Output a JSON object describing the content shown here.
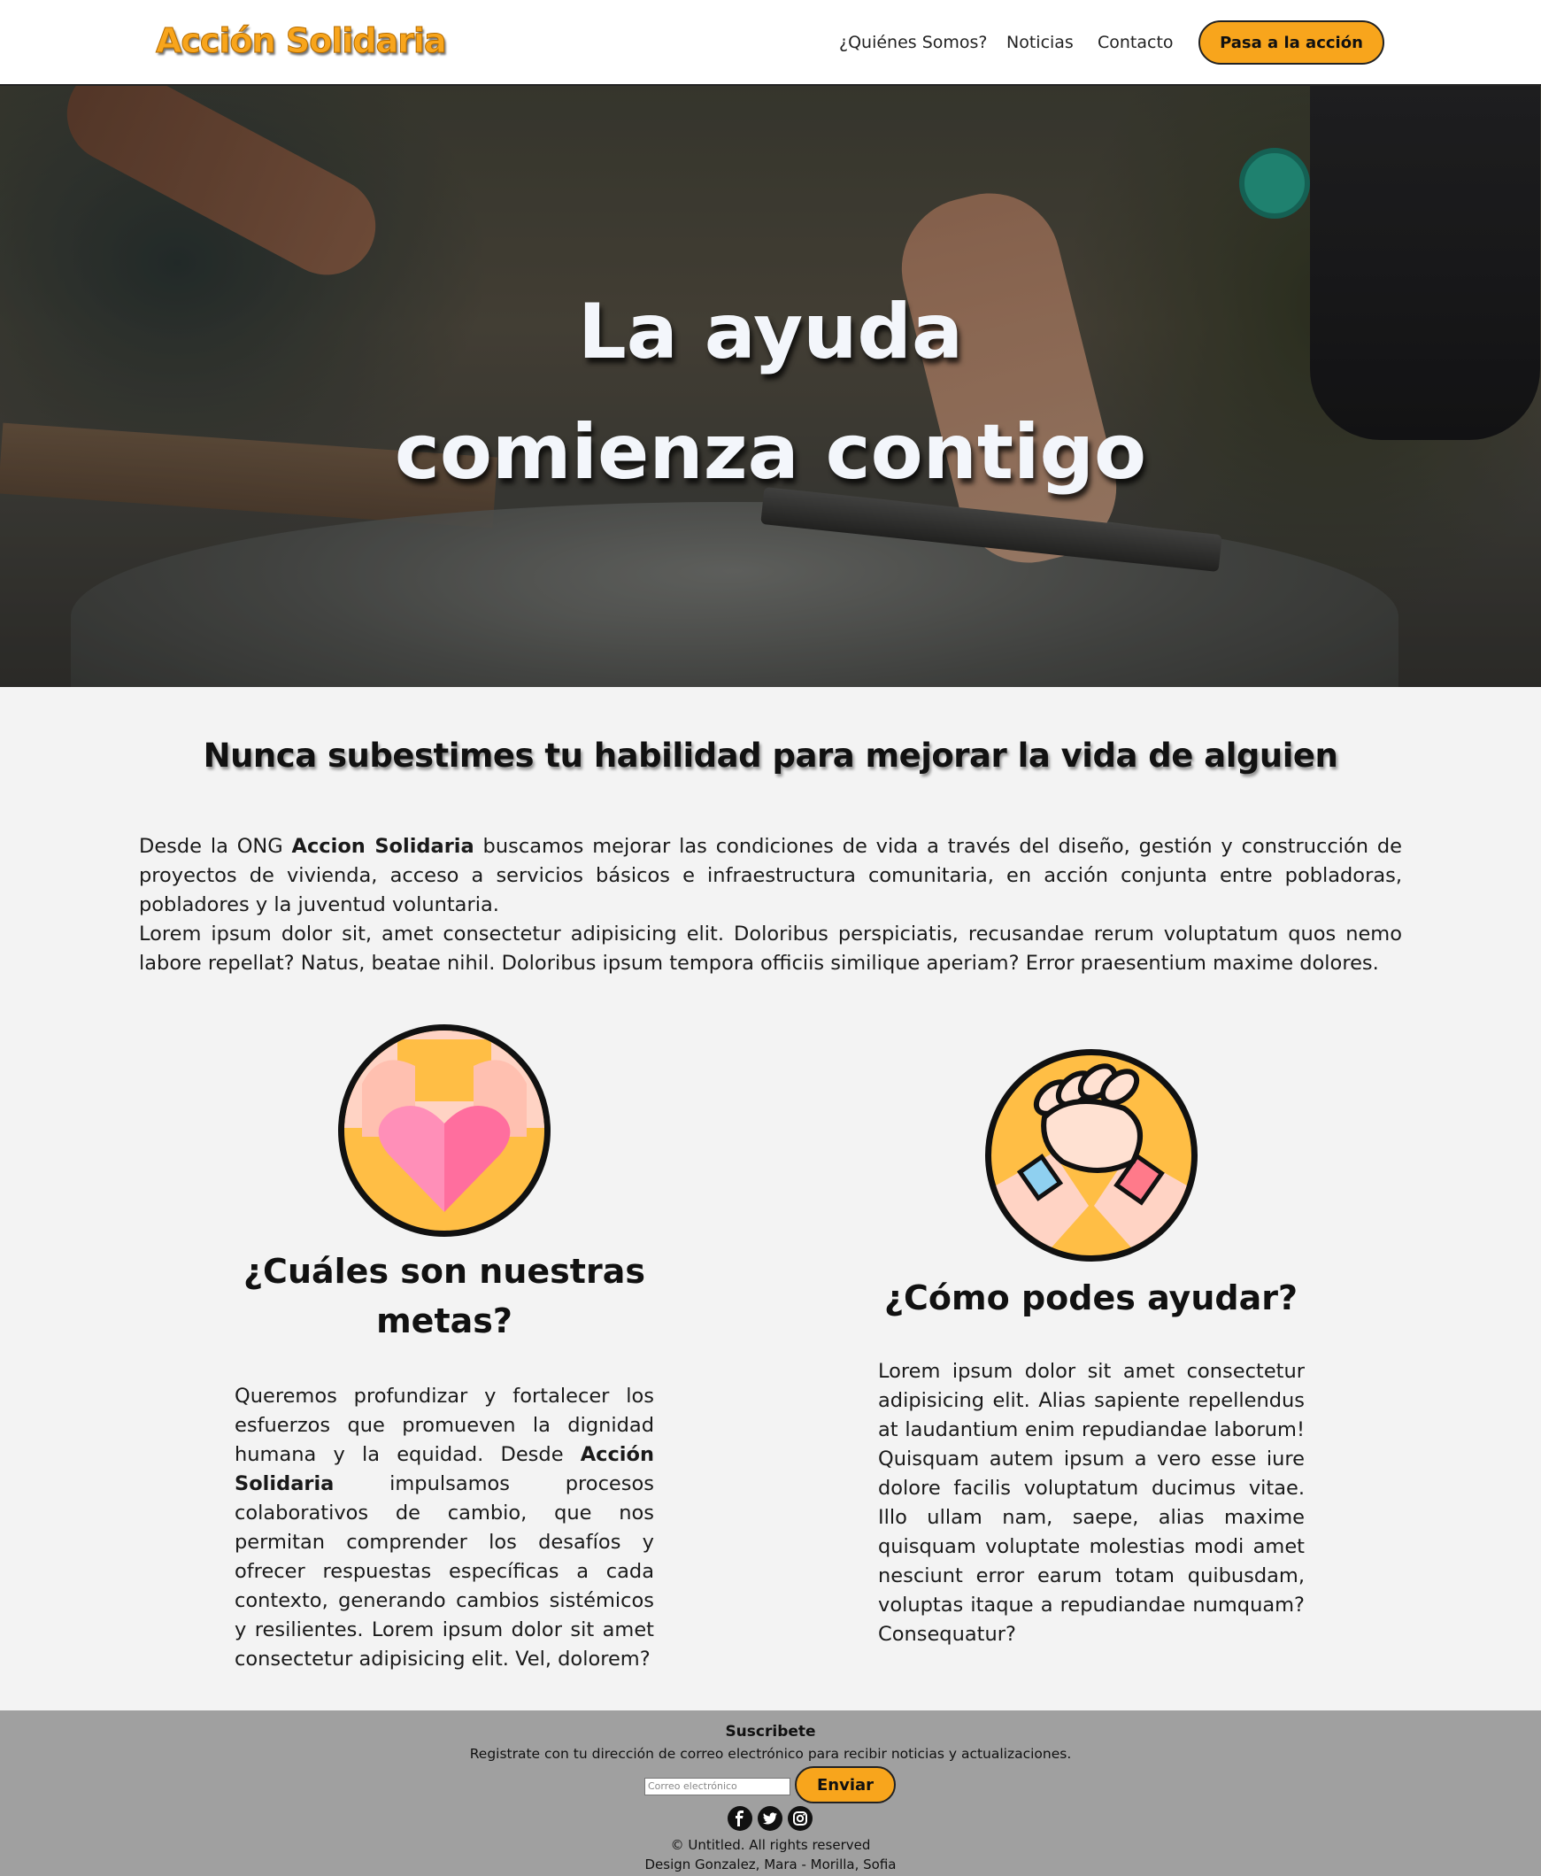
{
  "header": {
    "logo": "Acción Solidaria",
    "nav": [
      "¿Quiénes Somos?",
      "Noticias",
      "Contacto"
    ],
    "cta": "Pasa a la acción"
  },
  "hero": {
    "line1": "La ayuda",
    "line2": "comienza contigo"
  },
  "main": {
    "tagline": "Nunca subestimes tu habilidad para mejorar la vida de alguien",
    "intro": {
      "p1_before": "Desde la ONG ",
      "p1_bold": "Accion Solidaria",
      "p1_after": " buscamos mejorar las condiciones de vida a través del diseño, gestión y construcción de proyectos de vivienda, acceso a servicios básicos e infraestructura comunitaria, en acción conjunta entre pobladoras, pobladores y la juventud voluntaria.",
      "p2": "Lorem ipsum dolor sit, amet consectetur adipisicing elit. Doloribus perspiciatis, recusandae rerum voluptatum quos nemo labore repellat? Natus, beatae nihil. Doloribus ipsum tempora officiis similique aperiam? Error praesentium maxime dolores."
    },
    "goals": {
      "icon": "heart-hands-icon",
      "title": "¿Cuáles son nuestras metas?",
      "text_before": "Queremos profundizar y fortalecer los esfuerzos que promueven la dignidad humana y la equidad. Desde ",
      "text_bold": "Acción Solidaria",
      "text_after": " impulsamos procesos colaborativos de cambio, que nos permitan comprender los desafíos y ofrecer respuestas específicas a cada contexto, generando cambios sistémicos y resilientes. Lorem ipsum dolor sit amet consectetur adipisicing elit. Vel, dolorem?"
    },
    "help": {
      "icon": "handshake-icon",
      "title": "¿Cómo podes ayudar?",
      "text": "Lorem ipsum dolor sit amet consectetur adipisicing elit. Alias sapiente repellendus at laudantium enim repudiandae laborum! Quisquam autem ipsum a vero esse iure dolore facilis voluptatum ducimus vitae. Illo ullam nam, saepe, alias maxime quisquam voluptate molestias modi amet nesciunt error earum totam quibusdam, voluptas itaque a repudiandae numquam? Consequatur?"
    }
  },
  "footer": {
    "title": "Suscribete",
    "text": "Registrate con tu dirección de correo electrónico para recibir noticias y actualizaciones.",
    "email_placeholder": "Correo electrónico",
    "send": "Enviar",
    "socials": [
      "facebook-icon",
      "twitter-icon",
      "instagram-icon"
    ],
    "copyright": "© Untitled. All rights reserved",
    "design": "Design Gonzalez, Mara - Morilla, Sofia"
  },
  "colors": {
    "accent": "#f8a51c",
    "footer_bg": "#a0a0a0",
    "page_bg": "#f3f3f3"
  }
}
